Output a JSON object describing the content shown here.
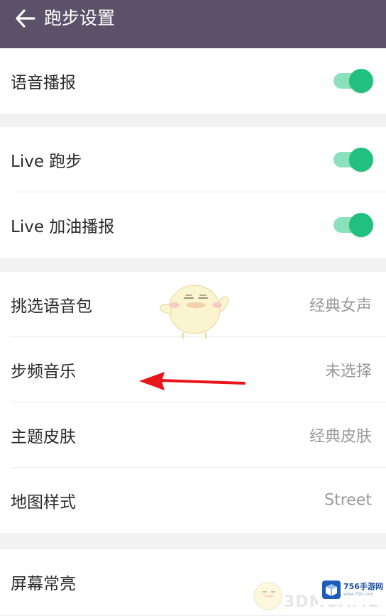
{
  "header": {
    "title": "跑步设置",
    "back_icon": "arrow-left-icon",
    "background_color": "#5b5169"
  },
  "groups": [
    {
      "rows": [
        {
          "label": "语音播报",
          "control": "toggle",
          "on": true
        }
      ]
    },
    {
      "rows": [
        {
          "label": "Live 跑步",
          "control": "toggle",
          "on": true
        },
        {
          "label": "Live 加油播报",
          "control": "toggle",
          "on": true
        }
      ]
    },
    {
      "rows": [
        {
          "label": "挑选语音包",
          "value": "经典女声"
        },
        {
          "label": "步频音乐",
          "value": "未选择"
        },
        {
          "label": "主题皮肤",
          "value": "经典皮肤"
        },
        {
          "label": "地图样式",
          "value": "Street"
        }
      ]
    },
    {
      "rows": [
        {
          "label": "屏幕常亮"
        }
      ]
    }
  ],
  "colors": {
    "toggle_on_knob": "#22c07f",
    "toggle_on_track": "#8be0bd",
    "annotation_arrow": "#e8161b"
  },
  "watermark": {
    "badge_text": "756手游网",
    "badge_sub": "www.756.com",
    "faint_text": "3DMGAME"
  }
}
